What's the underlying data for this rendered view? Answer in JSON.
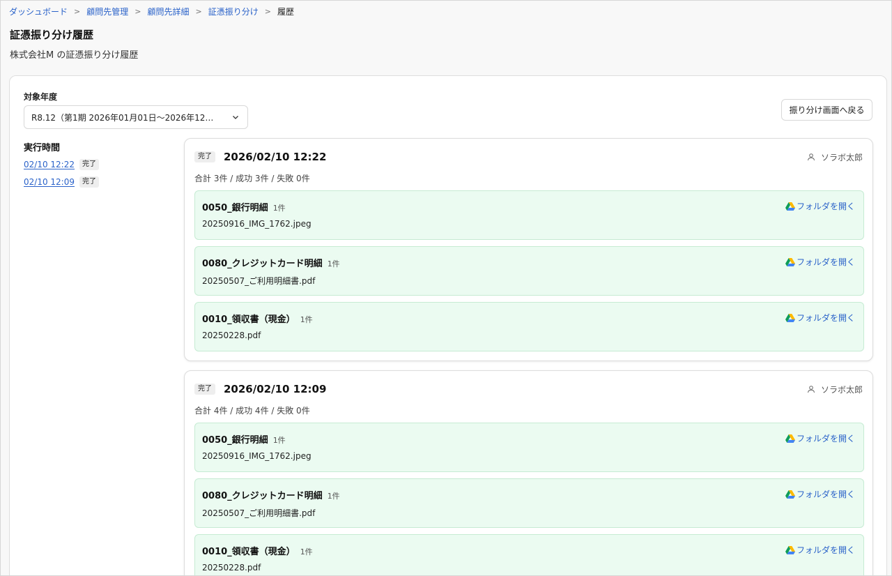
{
  "breadcrumb": [
    {
      "label": "ダッシュボード"
    },
    {
      "label": "顧問先管理"
    },
    {
      "label": "顧問先詳細"
    },
    {
      "label": "証憑振り分け"
    },
    {
      "label": "履歴"
    }
  ],
  "page": {
    "title": "証憑振り分け履歴",
    "subtitle": "株式会社M の証憑振り分け履歴"
  },
  "filter": {
    "label": "対象年度",
    "selected": "R8.12（第1期 2026年01月01日～2026年12…"
  },
  "back_button_label": "振り分け画面へ戻る",
  "sidebar": {
    "title": "実行時間",
    "runs": [
      {
        "time": "02/10 12:22",
        "status": "完了"
      },
      {
        "time": "02/10 12:09",
        "status": "完了"
      }
    ]
  },
  "runs": [
    {
      "status": "完了",
      "datetime": "2026/02/10 12:22",
      "user": "ソラボ太郎",
      "summary": "合計 3件 / 成功 3件 / 失敗 0件",
      "categories": [
        {
          "name": "0050_銀行明細",
          "count": "1件",
          "file": "20250916_IMG_1762.jpeg",
          "link": "フォルダを開く"
        },
        {
          "name": "0080_クレジットカード明細",
          "count": "1件",
          "file": "20250507_ご利用明細書.pdf",
          "link": "フォルダを開く"
        },
        {
          "name": "0010_領収書（現金）",
          "count": "1件",
          "file": "20250228.pdf",
          "link": "フォルダを開く"
        }
      ]
    },
    {
      "status": "完了",
      "datetime": "2026/02/10 12:09",
      "user": "ソラボ太郎",
      "summary": "合計 4件 / 成功 4件 / 失敗 0件",
      "categories": [
        {
          "name": "0050_銀行明細",
          "count": "1件",
          "file": "20250916_IMG_1762.jpeg",
          "link": "フォルダを開く"
        },
        {
          "name": "0080_クレジットカード明細",
          "count": "1件",
          "file": "20250507_ご利用明細書.pdf",
          "link": "フォルダを開く"
        },
        {
          "name": "0010_領収書（現金）",
          "count": "1件",
          "file": "20250228.pdf",
          "link": "フォルダを開く"
        }
      ]
    }
  ],
  "icons": {
    "chevron": "chevron-down-icon",
    "user": "user-icon",
    "drive": "google-drive-icon"
  },
  "colors": {
    "link": "#2a62c9",
    "category_bg": "#ebfbf1",
    "category_border": "#c6ebd3"
  }
}
